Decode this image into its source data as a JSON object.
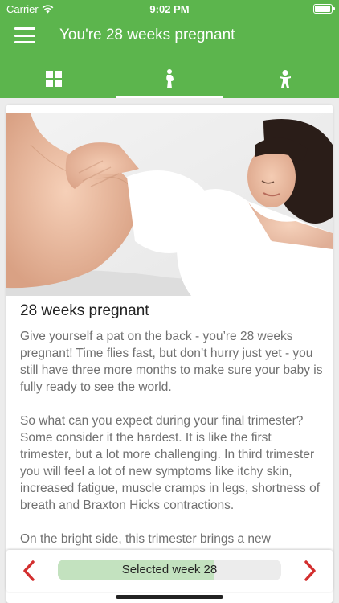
{
  "status": {
    "carrier": "Carrier",
    "time": "9:02 PM"
  },
  "header": {
    "title": "You're 28 weeks pregnant"
  },
  "tabs": [
    {
      "icon": "grid-icon",
      "active": false
    },
    {
      "icon": "pregnant-woman-icon",
      "active": true
    },
    {
      "icon": "baby-icon",
      "active": false
    }
  ],
  "article": {
    "image": "pregnant-woman-lying-photo",
    "heading": "28 weeks pregnant",
    "paragraphs": [
      "Give yourself a pat on the back - you’re 28 weeks pregnant! Time flies fast, but don’t hurry just yet - you still have three more months to make sure your baby is fully ready to see the world.",
      "So what can you expect during your final trimester? Some consider it the hardest. It is like the first trimester, but a lot more challenging. In third trimester you will feel a lot of new symptoms like itchy skin, increased fatigue, muscle cramps in legs, shortness of breath and Braxton Hicks contractions.",
      "On the bright side, this trimester brings a new"
    ]
  },
  "week_selector": {
    "label": "Selected week 28",
    "progress": 0.7,
    "prev_icon": "chevron-left-icon",
    "next_icon": "chevron-right-icon"
  },
  "colors": {
    "brand": "#5cb54d",
    "arrow": "#d32f2f",
    "progress": "#c3e2bf"
  }
}
